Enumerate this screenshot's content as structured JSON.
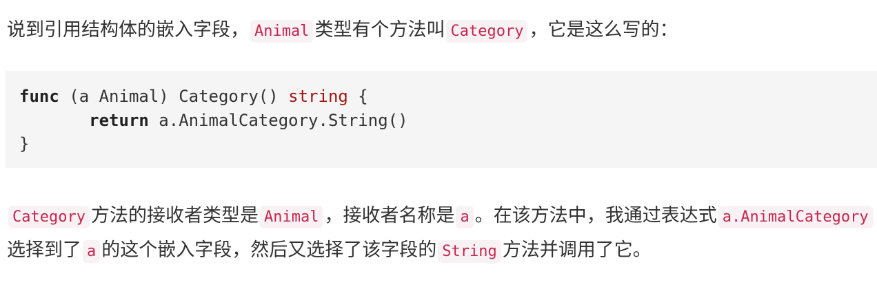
{
  "para1": {
    "t1": "说到引用结构体的嵌入字段，",
    "c1": "Animal",
    "t2": "类型有个方法叫",
    "c2": "Category",
    "t3": "，它是这么写的："
  },
  "code": {
    "l1_kw": "func",
    "l1_mid": " (a Animal) Category() ",
    "l1_type": "string",
    "l1_end": " {",
    "l2_indent": "       ",
    "l2_kw": "return",
    "l2_rest": " a.AnimalCategory.String()",
    "l3": "}"
  },
  "para2": {
    "c1": "Category",
    "t1": "方法的接收者类型是",
    "c2": "Animal",
    "t2": "，接收者名称是",
    "c3": "a",
    "t3": "。在该方法中，我通过表达式",
    "c4": "a.AnimalCategory",
    "t4": "选择到了",
    "c5": "a",
    "t5": "的这个嵌入字段，然后又选择了该字段的",
    "c6": "String",
    "t6": "方法并调用了它。"
  }
}
